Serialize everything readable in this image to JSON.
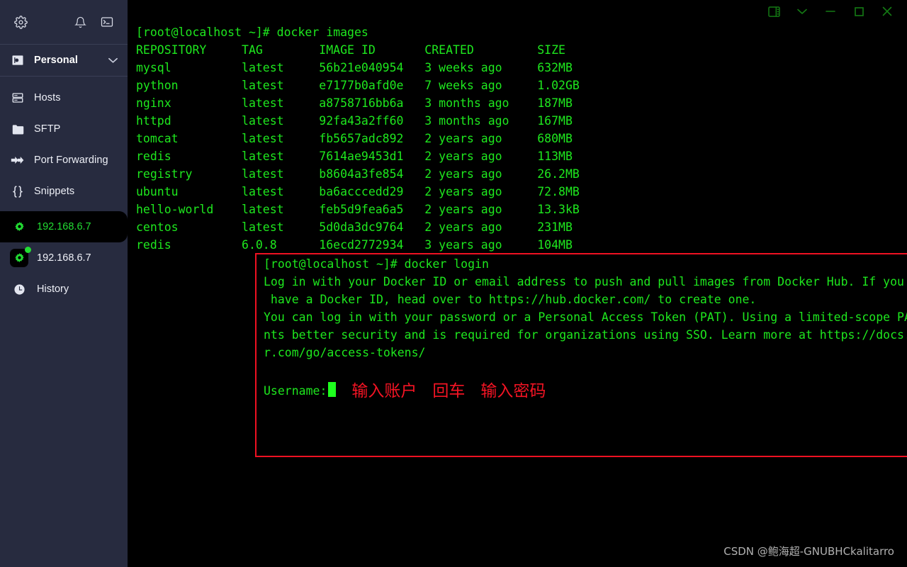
{
  "sidebar": {
    "toolbar": [
      {
        "name": "settings-icon",
        "label": "Settings"
      },
      {
        "name": "notifications-icon",
        "label": "Notifications"
      },
      {
        "name": "terminal-icon",
        "label": "New Terminal"
      }
    ],
    "vault": {
      "label": "Personal",
      "icon": "vault-icon",
      "chevron": "∨"
    },
    "items": [
      {
        "label": "Hosts",
        "icon": "server-icon"
      },
      {
        "label": "SFTP",
        "icon": "folder-icon"
      },
      {
        "label": "Port Forwarding",
        "icon": "arrows-icon"
      },
      {
        "label": "Snippets",
        "icon": "braces-icon"
      }
    ],
    "hosts": [
      {
        "label": "192.168.6.7",
        "active": true,
        "status": false
      },
      {
        "label": "192.168.6.7",
        "active": false,
        "status": true
      }
    ],
    "history": {
      "label": "History",
      "icon": "clock-icon"
    }
  },
  "window_controls": [
    {
      "name": "split-pane-icon",
      "label": "Split pane"
    },
    {
      "name": "chevron-down-icon",
      "label": "More"
    },
    {
      "name": "minimize-icon",
      "label": "Minimize"
    },
    {
      "name": "maximize-icon",
      "label": "Maximize"
    },
    {
      "name": "close-icon",
      "label": "Close"
    }
  ],
  "terminal": {
    "prompt_images": "[root@localhost ~]# docker images",
    "table_header": "REPOSITORY     TAG        IMAGE ID       CREATED         SIZE",
    "rows": [
      "mysql          latest     56b21e040954   3 weeks ago     632MB",
      "python         latest     e7177b0afd0e   7 weeks ago     1.02GB",
      "nginx          latest     a8758716bb6a   3 months ago    187MB",
      "httpd          latest     92fa43a2ff60   3 months ago    167MB",
      "tomcat         latest     fb5657adc892   2 years ago     680MB",
      "redis          latest     7614ae9453d1   2 years ago     113MB",
      "registry       latest     b8604a3fe854   2 years ago     26.2MB",
      "ubuntu         latest     ba6acccedd29   2 years ago     72.8MB",
      "hello-world    latest     feb5d9fea6a5   2 years ago     13.3kB",
      "centos         latest     5d0da3dc9764   2 years ago     231MB",
      "redis          6.0.8      16ecd2772934   3 years ago     104MB"
    ],
    "prompt_login": "[root@localhost ~]# docker login",
    "login_output": [
      "Log in with your Docker ID or email address to push and pull images from Docker Hub. If you don't",
      " have a Docker ID, head over to https://hub.docker.com/ to create one.",
      "You can log in with your password or a Personal Access Token (PAT). Using a limited-scope PAT gra",
      "nts better security and is required for organizations using SSO. Learn more at https://docs.docke",
      "r.com/go/access-tokens/"
    ],
    "username_prompt": "Username:",
    "annotations": [
      "输入账户",
      "回车",
      "输入密码"
    ]
  },
  "watermark": "CSDN @鲍海超-GNUBHCkalitarro",
  "colors": {
    "terminal_green": "#1ee81e",
    "annotation_red": "#f41424",
    "sidebar_bg": "#272b3f",
    "status_green": "#22dd33",
    "window_ctrl_green": "#147a14"
  }
}
